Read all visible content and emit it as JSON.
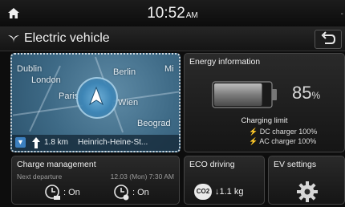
{
  "status": {
    "time": "10:52",
    "ampm": "AM",
    "edge_mark": "-"
  },
  "header": {
    "title": "Electric vehicle"
  },
  "map": {
    "labels": [
      {
        "text": "Dublin"
      },
      {
        "text": "London"
      },
      {
        "text": "Paris"
      },
      {
        "text": "Berlin"
      },
      {
        "text": "Wien"
      },
      {
        "text": "Beograd"
      },
      {
        "text": "Mi"
      }
    ],
    "distance": "1.8 km",
    "street": "Heinrich-Heine-St..."
  },
  "energy": {
    "title": "Energy information",
    "battery_percent": 85,
    "percent_value": "85",
    "percent_unit": "%",
    "charging_limit_label": "Charging limit",
    "dc_line": "DC charger 100%",
    "ac_line": "AC charger 100%"
  },
  "charge": {
    "title": "Charge management",
    "next_departure_label": "Next departure",
    "next_departure_time": "12.03 (Mon) 7:30 AM",
    "timer1": ": On",
    "timer2": ": On"
  },
  "eco": {
    "title": "ECO driving",
    "badge": "CO2",
    "value": "1.1 kg"
  },
  "ev_settings": {
    "title": "EV settings"
  },
  "colors": {
    "battery_fill": "#3a3a3a",
    "map_water": "#3e6a86",
    "nav_accent": "#3d85b5"
  }
}
